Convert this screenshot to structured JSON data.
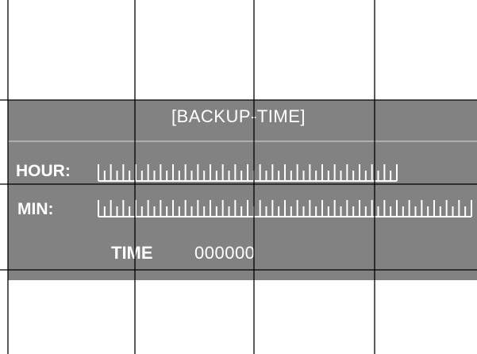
{
  "title": "[BACKUP-TIME]",
  "hour": {
    "label": "HOUR:",
    "slot_count": 24
  },
  "minute": {
    "label": "MIN:",
    "slot_count": 30
  },
  "time": {
    "label": "TIME",
    "value": "000000"
  },
  "colors": {
    "panel": "#828282",
    "text": "#ffffff",
    "grid": "#000000",
    "divider": "#bdbdbd"
  }
}
